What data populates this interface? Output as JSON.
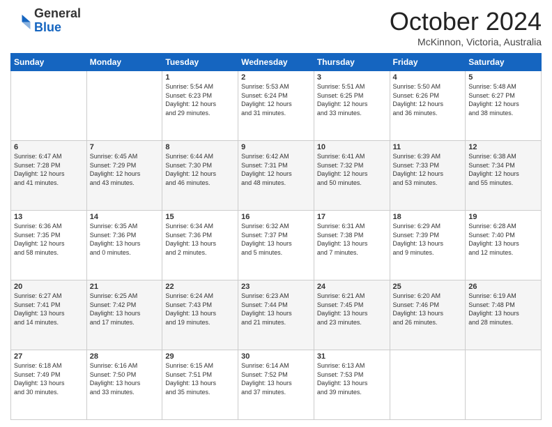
{
  "header": {
    "logo_general": "General",
    "logo_blue": "Blue",
    "month_year": "October 2024",
    "location": "McKinnon, Victoria, Australia"
  },
  "days_of_week": [
    "Sunday",
    "Monday",
    "Tuesday",
    "Wednesday",
    "Thursday",
    "Friday",
    "Saturday"
  ],
  "weeks": [
    [
      {
        "day": "",
        "info": ""
      },
      {
        "day": "",
        "info": ""
      },
      {
        "day": "1",
        "info": "Sunrise: 5:54 AM\nSunset: 6:23 PM\nDaylight: 12 hours\nand 29 minutes."
      },
      {
        "day": "2",
        "info": "Sunrise: 5:53 AM\nSunset: 6:24 PM\nDaylight: 12 hours\nand 31 minutes."
      },
      {
        "day": "3",
        "info": "Sunrise: 5:51 AM\nSunset: 6:25 PM\nDaylight: 12 hours\nand 33 minutes."
      },
      {
        "day": "4",
        "info": "Sunrise: 5:50 AM\nSunset: 6:26 PM\nDaylight: 12 hours\nand 36 minutes."
      },
      {
        "day": "5",
        "info": "Sunrise: 5:48 AM\nSunset: 6:27 PM\nDaylight: 12 hours\nand 38 minutes."
      }
    ],
    [
      {
        "day": "6",
        "info": "Sunrise: 6:47 AM\nSunset: 7:28 PM\nDaylight: 12 hours\nand 41 minutes."
      },
      {
        "day": "7",
        "info": "Sunrise: 6:45 AM\nSunset: 7:29 PM\nDaylight: 12 hours\nand 43 minutes."
      },
      {
        "day": "8",
        "info": "Sunrise: 6:44 AM\nSunset: 7:30 PM\nDaylight: 12 hours\nand 46 minutes."
      },
      {
        "day": "9",
        "info": "Sunrise: 6:42 AM\nSunset: 7:31 PM\nDaylight: 12 hours\nand 48 minutes."
      },
      {
        "day": "10",
        "info": "Sunrise: 6:41 AM\nSunset: 7:32 PM\nDaylight: 12 hours\nand 50 minutes."
      },
      {
        "day": "11",
        "info": "Sunrise: 6:39 AM\nSunset: 7:33 PM\nDaylight: 12 hours\nand 53 minutes."
      },
      {
        "day": "12",
        "info": "Sunrise: 6:38 AM\nSunset: 7:34 PM\nDaylight: 12 hours\nand 55 minutes."
      }
    ],
    [
      {
        "day": "13",
        "info": "Sunrise: 6:36 AM\nSunset: 7:35 PM\nDaylight: 12 hours\nand 58 minutes."
      },
      {
        "day": "14",
        "info": "Sunrise: 6:35 AM\nSunset: 7:36 PM\nDaylight: 13 hours\nand 0 minutes."
      },
      {
        "day": "15",
        "info": "Sunrise: 6:34 AM\nSunset: 7:36 PM\nDaylight: 13 hours\nand 2 minutes."
      },
      {
        "day": "16",
        "info": "Sunrise: 6:32 AM\nSunset: 7:37 PM\nDaylight: 13 hours\nand 5 minutes."
      },
      {
        "day": "17",
        "info": "Sunrise: 6:31 AM\nSunset: 7:38 PM\nDaylight: 13 hours\nand 7 minutes."
      },
      {
        "day": "18",
        "info": "Sunrise: 6:29 AM\nSunset: 7:39 PM\nDaylight: 13 hours\nand 9 minutes."
      },
      {
        "day": "19",
        "info": "Sunrise: 6:28 AM\nSunset: 7:40 PM\nDaylight: 13 hours\nand 12 minutes."
      }
    ],
    [
      {
        "day": "20",
        "info": "Sunrise: 6:27 AM\nSunset: 7:41 PM\nDaylight: 13 hours\nand 14 minutes."
      },
      {
        "day": "21",
        "info": "Sunrise: 6:25 AM\nSunset: 7:42 PM\nDaylight: 13 hours\nand 17 minutes."
      },
      {
        "day": "22",
        "info": "Sunrise: 6:24 AM\nSunset: 7:43 PM\nDaylight: 13 hours\nand 19 minutes."
      },
      {
        "day": "23",
        "info": "Sunrise: 6:23 AM\nSunset: 7:44 PM\nDaylight: 13 hours\nand 21 minutes."
      },
      {
        "day": "24",
        "info": "Sunrise: 6:21 AM\nSunset: 7:45 PM\nDaylight: 13 hours\nand 23 minutes."
      },
      {
        "day": "25",
        "info": "Sunrise: 6:20 AM\nSunset: 7:46 PM\nDaylight: 13 hours\nand 26 minutes."
      },
      {
        "day": "26",
        "info": "Sunrise: 6:19 AM\nSunset: 7:48 PM\nDaylight: 13 hours\nand 28 minutes."
      }
    ],
    [
      {
        "day": "27",
        "info": "Sunrise: 6:18 AM\nSunset: 7:49 PM\nDaylight: 13 hours\nand 30 minutes."
      },
      {
        "day": "28",
        "info": "Sunrise: 6:16 AM\nSunset: 7:50 PM\nDaylight: 13 hours\nand 33 minutes."
      },
      {
        "day": "29",
        "info": "Sunrise: 6:15 AM\nSunset: 7:51 PM\nDaylight: 13 hours\nand 35 minutes."
      },
      {
        "day": "30",
        "info": "Sunrise: 6:14 AM\nSunset: 7:52 PM\nDaylight: 13 hours\nand 37 minutes."
      },
      {
        "day": "31",
        "info": "Sunrise: 6:13 AM\nSunset: 7:53 PM\nDaylight: 13 hours\nand 39 minutes."
      },
      {
        "day": "",
        "info": ""
      },
      {
        "day": "",
        "info": ""
      }
    ]
  ]
}
